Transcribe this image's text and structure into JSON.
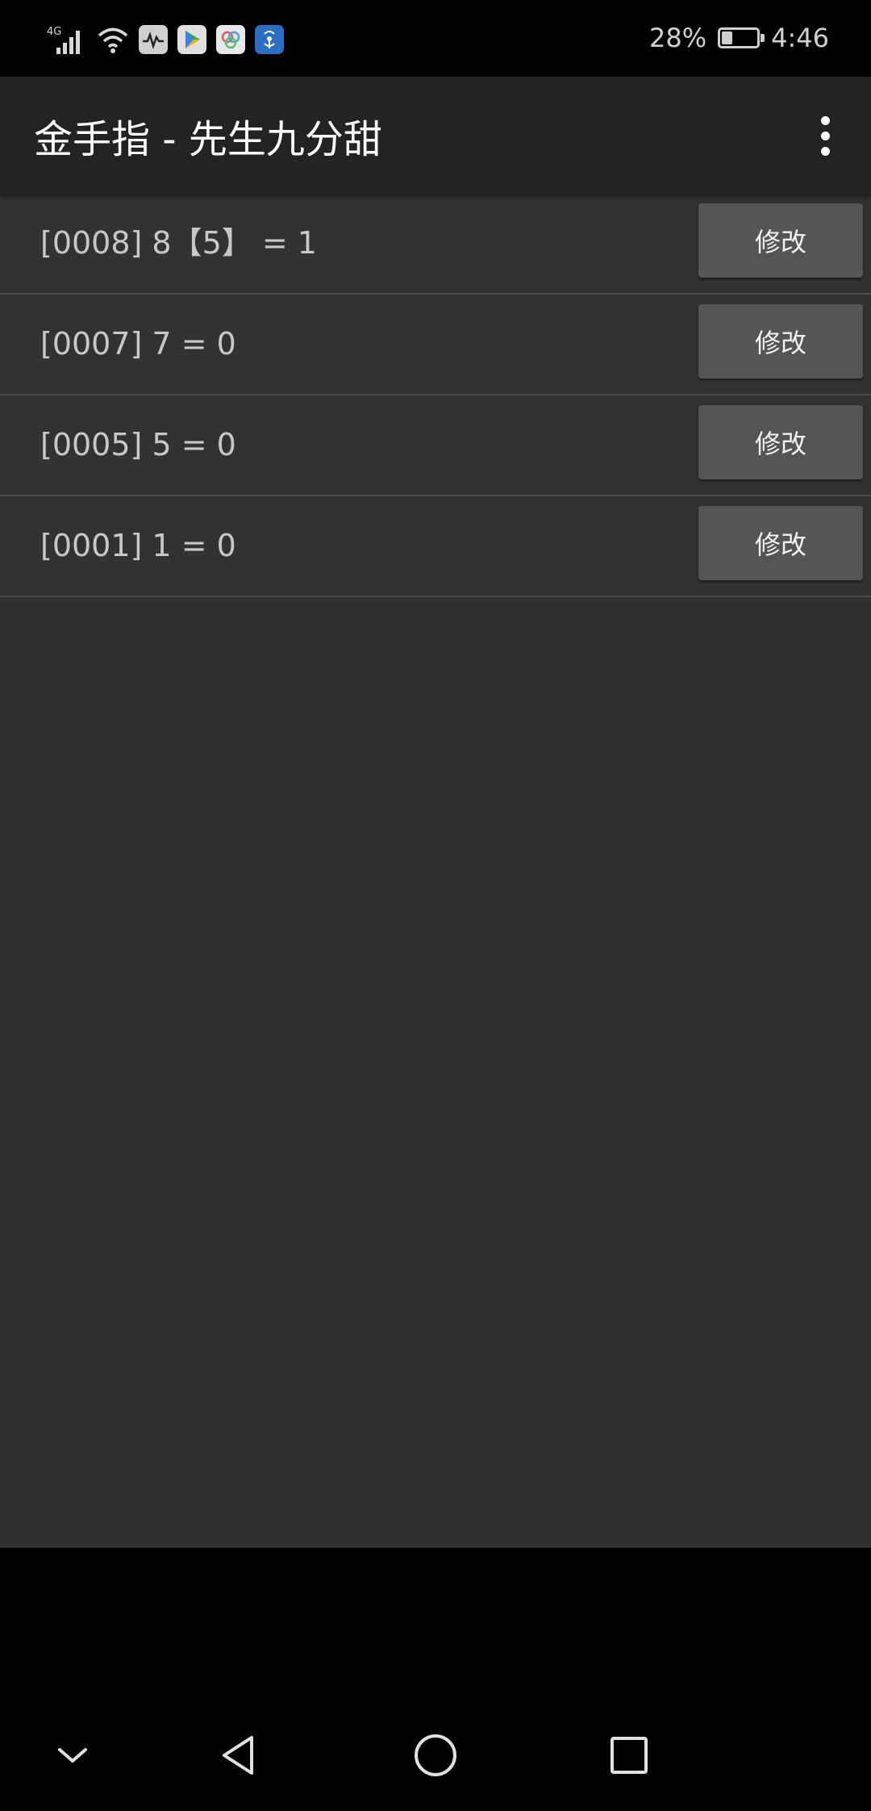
{
  "status_bar": {
    "network_type": "4G",
    "battery_percent_text": "28%",
    "battery_level": 0.28,
    "time": "4:46"
  },
  "app_bar": {
    "title": "金手指 - 先生九分甜"
  },
  "cheat_list": {
    "items": [
      {
        "text": "[0008] 8【5】 = 1",
        "button_label": "修改"
      },
      {
        "text": "[0007] 7 = 0",
        "button_label": "修改"
      },
      {
        "text": "[0005] 5 = 0",
        "button_label": "修改"
      },
      {
        "text": "[0001] 1 = 0",
        "button_label": "修改"
      }
    ]
  },
  "colors": {
    "app_bar_bg": "#232323",
    "content_bg": "#303030",
    "button_bg": "#555555",
    "text": "#c8c8c8"
  }
}
